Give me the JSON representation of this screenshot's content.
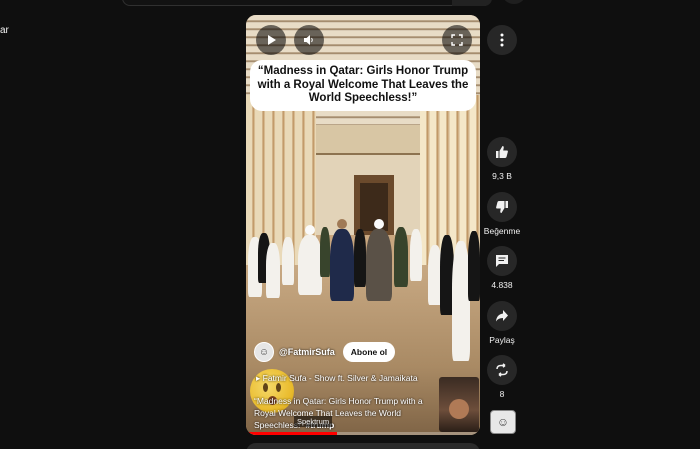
{
  "sidebar": {
    "cut_label": "ar"
  },
  "player": {
    "overlay_title": "“Madness in Qatar: Girls Honor Trump with a Royal Welcome That Leaves the World Speechless!”",
    "channel_name": "@FatmirSufa",
    "subscribe_label": "Abone ol",
    "sound_label": "▸ Fatmir Sufa - Show ft. Silver & Jamaikata",
    "description": "“Madness in Qatar: Girls Honor Trump with a Royal Welcome That Leaves the World Speechless!” ",
    "hashtag": "#trump",
    "spektrum_label": "Spektrum",
    "progress": 0.39,
    "icons": {
      "play": "play-icon",
      "volume": "volume-icon",
      "fullscreen": "fullscreen-icon"
    }
  },
  "actions": {
    "like_count": "9,3 B",
    "dislike_label": "Beğenme",
    "comment_count": "4.838",
    "share_label": "Paylaş",
    "remix_count": "8"
  },
  "colors": {
    "background": "#0f0f0f",
    "action_button": "#272727",
    "progress": "#ff0000"
  }
}
